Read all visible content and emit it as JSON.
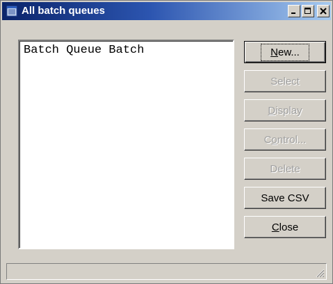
{
  "window": {
    "title": "All batch queues",
    "title_icon": "batch-queue-icon",
    "controls": {
      "minimize_icon": "minimize-icon",
      "maximize_icon": "maximize-icon",
      "close_icon": "close-icon"
    }
  },
  "list": {
    "header_text": "Batch Queue Batch",
    "items": []
  },
  "buttons": [
    {
      "id": "new",
      "label": "New...",
      "accel": "N",
      "enabled": true,
      "default": true
    },
    {
      "id": "select",
      "label": "Select",
      "accel": "",
      "enabled": false,
      "default": false
    },
    {
      "id": "display",
      "label": "Display",
      "accel": "D",
      "enabled": false,
      "default": false
    },
    {
      "id": "control",
      "label": "Control...",
      "accel": "o",
      "enabled": false,
      "default": false
    },
    {
      "id": "delete",
      "label": "Delete",
      "accel": "",
      "enabled": false,
      "default": false
    },
    {
      "id": "save_csv",
      "label": "Save CSV",
      "accel": "",
      "enabled": true,
      "default": false
    },
    {
      "id": "close",
      "label": "Close",
      "accel": "C",
      "enabled": true,
      "default": false
    }
  ],
  "statusbar": {
    "text": "",
    "grip_icon": "resize-grip-icon"
  },
  "colors": {
    "title_gradient_start": "#0a246a",
    "title_gradient_end": "#a6caf0",
    "face": "#d4d0c8",
    "disabled_text": "#a0a0a0"
  }
}
